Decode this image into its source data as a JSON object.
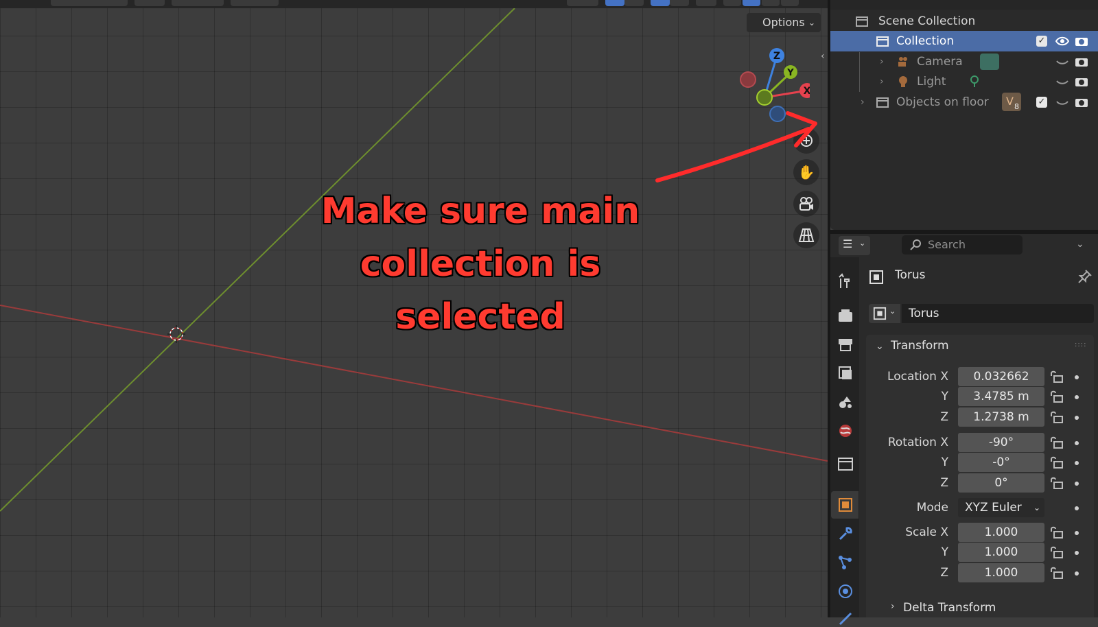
{
  "viewport": {
    "options_label": "Options",
    "annotation_lines": [
      "Make sure main",
      "collection is",
      "selected"
    ]
  },
  "outliner": {
    "scene_collection_label": "Scene Collection",
    "rows": [
      {
        "label": "Collection",
        "selected": true
      },
      {
        "label": "Camera"
      },
      {
        "label": "Light"
      },
      {
        "label": "Objects on floor",
        "badge": "8"
      }
    ]
  },
  "properties": {
    "search_placeholder": "Search",
    "object_name": "Torus",
    "datablock_name": "Torus",
    "panel_title": "Transform",
    "location": {
      "label_x": "Location X",
      "label_y": "Y",
      "label_z": "Z",
      "x": "0.032662",
      "y": "3.4785 m",
      "z": "1.2738 m"
    },
    "rotation": {
      "label_x": "Rotation X",
      "label_y": "Y",
      "label_z": "Z",
      "x": "-90°",
      "y": "-0°",
      "z": "0°"
    },
    "mode": {
      "label": "Mode",
      "value": "XYZ Euler"
    },
    "scale": {
      "label_x": "Scale X",
      "label_y": "Y",
      "label_z": "Z",
      "x": "1.000",
      "y": "1.000",
      "z": "1.000"
    },
    "delta_transform_label": "Delta Transform"
  },
  "gizmo": {
    "x_label": "X",
    "y_label": "Y",
    "z_label": "Z"
  },
  "colors": {
    "annotation_red": "#ff3b30",
    "selection_blue": "#4b6ca6",
    "x_axis": "#e6424e",
    "y_axis": "#8ab622",
    "z_axis": "#3e82e0"
  }
}
